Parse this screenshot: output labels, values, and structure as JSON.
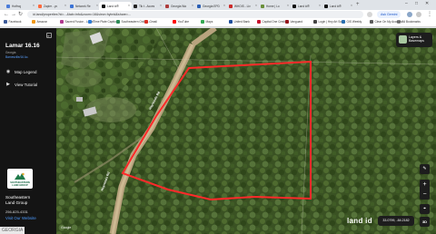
{
  "browser": {
    "tabs": [
      {
        "title": "Hotfrog",
        "color": "#4a7cd9",
        "active": false
      },
      {
        "title": "Zapier - yo",
        "color": "#ff6a3d",
        "active": false
      },
      {
        "title": "Network Re",
        "color": "#3b73d6",
        "active": false
      },
      {
        "title": "Land id®",
        "color": "#111111",
        "active": true
      },
      {
        "title": "Tik t - Acces",
        "color": "#222222",
        "active": false
      },
      {
        "title": "Georgia Wa",
        "color": "#ad3b3b",
        "active": false
      },
      {
        "title": "Georgia EPD",
        "color": "#2b5fb4",
        "active": false
      },
      {
        "title": "WHOIS - Liv",
        "color": "#cc2a2a",
        "active": false
      },
      {
        "title": "Home | Lo",
        "color": "#6a8f3a",
        "active": false
      },
      {
        "title": "Land id®",
        "color": "#111111",
        "active": false
      },
      {
        "title": "Land id®",
        "color": "#111111",
        "active": false
      }
    ],
    "new_tab": "+",
    "url": "id.land/properties?id=...&tab=info&zoom=16&view=hybrid&share=...",
    "ask_button": "Ask Gemini",
    "bookmarks": [
      {
        "label": "Facebook",
        "color": "#3b5998"
      },
      {
        "label": "Amazon",
        "color": "#f09819"
      },
      {
        "label": "Sacred Fusion - Legal",
        "color": "#b03a8f"
      },
      {
        "label": "Time Plate Caption",
        "color": "#2e7dd7"
      },
      {
        "label": "Southeastern Online...",
        "color": "#2e8b57"
      },
      {
        "label": "Gmail",
        "color": "#d93025"
      },
      {
        "label": "YouTube",
        "color": "#ff0000"
      },
      {
        "label": "Maps",
        "color": "#34a853"
      },
      {
        "label": "United Bank",
        "color": "#1f4e9b"
      },
      {
        "label": "Capital One Credit...",
        "color": "#c8102e"
      },
      {
        "label": "Vanguard",
        "color": "#96151d"
      },
      {
        "label": "Login | Hey Art Sou...",
        "color": "#444444"
      },
      {
        "label": "GIS Weekly",
        "color": "#2a6fb0"
      },
      {
        "label": "Clear On My Account",
        "color": "#5b5b5b"
      }
    ],
    "all_bookmarks": "All Bookmarks"
  },
  "sidebar": {
    "collapse_icon": "panel-collapse-icon",
    "property_title": "Lamar 16.16",
    "property_subtitle": "Georgia",
    "acres_link": "Barnesville/16 Ac.",
    "menu": [
      {
        "label": "Map Legend",
        "icon": "legend-icon"
      },
      {
        "label": "View Tutorial",
        "icon": "play-icon"
      }
    ],
    "agent": {
      "logo_text": "SOUTHEASTERN LAND GROUP",
      "name_line1": "Southeastern",
      "name_line2": "Land Group",
      "phone": "256-825-4331",
      "website": "Visit Our Website"
    },
    "state_badge": "GEORGIA"
  },
  "map": {
    "layers_label_1": "Layers &",
    "layers_label_2": "Basemaps",
    "zoom_in": "+",
    "zoom_out": "−",
    "mode_3d": "3D",
    "brand": "land id",
    "coordinates": "33.0799, -84.2182",
    "road_label": "Hayneeds Rd",
    "road_label_2": "Hayneeds Rd",
    "attribution": "Google",
    "boundary_color": "#ff2a2a",
    "road_color": "#b8a37e"
  }
}
